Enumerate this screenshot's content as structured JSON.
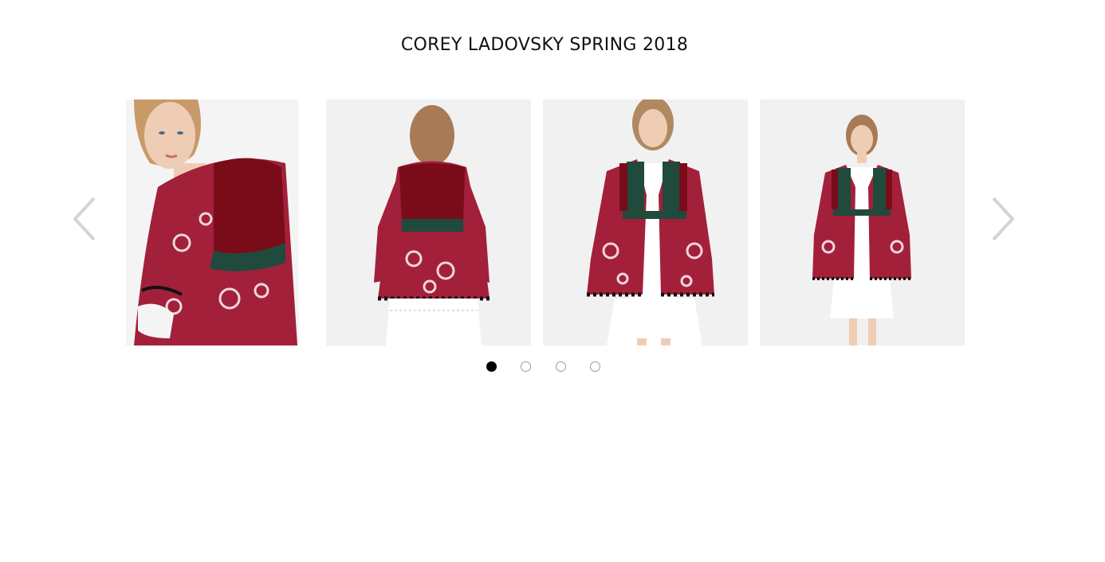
{
  "collection": {
    "title": "COREY LADOVSKY SPRING 2018"
  },
  "carousel": {
    "prev_icon": "chevron-left-icon",
    "next_icon": "chevron-right-icon",
    "slides": [
      {
        "view": "side-closeup"
      },
      {
        "view": "back"
      },
      {
        "view": "front-open"
      },
      {
        "view": "front-full"
      }
    ],
    "pagination": {
      "count": 4,
      "active_index": 0
    }
  },
  "colors": {
    "fabric_red": "#a3203a",
    "velvet_red": "#7a0c1a",
    "trim_green": "#1f4a3c",
    "dress_white": "#f3f3f3",
    "arrow_gray": "#d4d4d4",
    "dot_active": "#000000"
  }
}
